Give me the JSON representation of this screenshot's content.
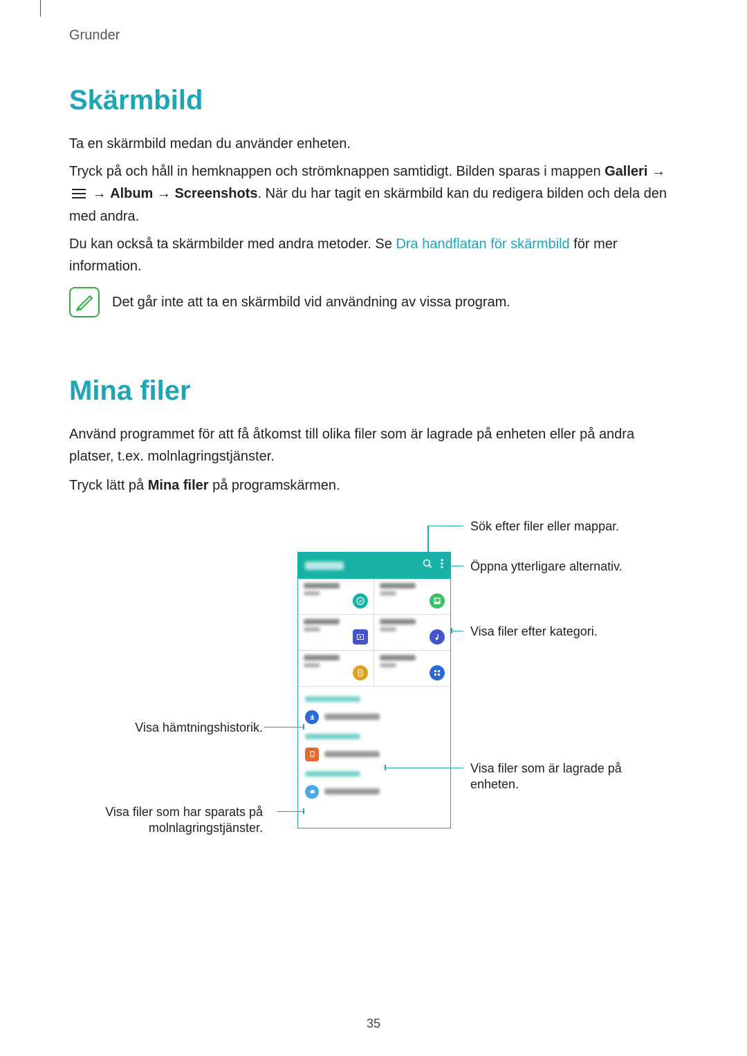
{
  "breadcrumb": "Grunder",
  "section1": {
    "heading": "Skärmbild",
    "p1": "Ta en skärmbild medan du använder enheten.",
    "p2_a": "Tryck på och håll in hemknappen och strömknappen samtidigt. Bilden sparas i mappen ",
    "p2_gallery": "Galleri",
    "p2_arrow1": " → ",
    "p2_arrow2": " → ",
    "p2_album": "Album",
    "p2_arrow3": " → ",
    "p2_screenshots": "Screenshots",
    "p2_b": ". När du har tagit en skärmbild kan du redigera bilden och dela den med andra.",
    "p3_a": "Du kan också ta skärmbilder med andra metoder. Se ",
    "p3_link": "Dra handflatan för skärmbild",
    "p3_b": " för mer information.",
    "note": "Det går inte att ta en skärmbild vid användning av vissa program."
  },
  "section2": {
    "heading": "Mina filer",
    "p1": "Använd programmet för att få åtkomst till olika filer som är lagrade på enheten eller på andra platser, t.ex. molnlagringstjänster.",
    "p2_a": "Tryck lätt på ",
    "p2_bold": "Mina filer",
    "p2_b": " på programskärmen."
  },
  "callouts": {
    "search": "Sök efter filer eller mappar.",
    "more": "Öppna ytterligare alternativ.",
    "category": "Visa filer efter kategori.",
    "download": "Visa hämtningshistorik.",
    "device": "Visa filer som är lagrade på enheten.",
    "cloud": "Visa filer som har sparats på molnlagringstjänster."
  },
  "page_number": "35"
}
